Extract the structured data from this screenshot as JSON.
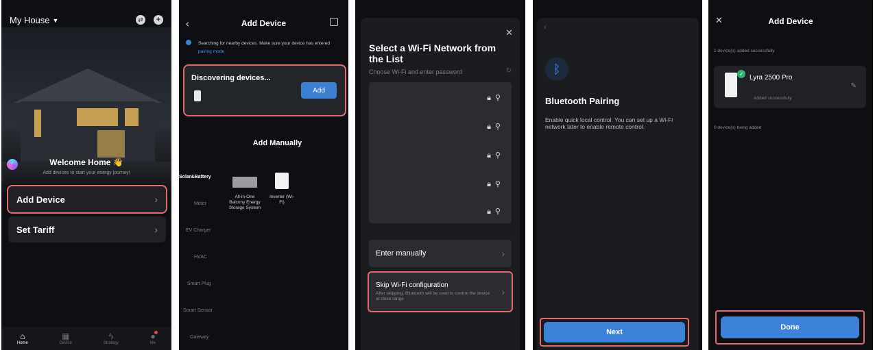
{
  "screen1": {
    "house_name": "My House",
    "title": "Welcome Home",
    "title_emoji": "👋",
    "subtitle": "Add devices to start your energy journey!",
    "menu": [
      {
        "label": "Add Device"
      },
      {
        "label": "Set Tariff"
      }
    ],
    "tabs": [
      {
        "label": "Home",
        "icon": "home-icon"
      },
      {
        "label": "Device",
        "icon": "device-icon"
      },
      {
        "label": "Strategy",
        "icon": "strategy-icon"
      },
      {
        "label": "Me",
        "icon": "me-icon"
      }
    ]
  },
  "screen2": {
    "title": "Add Device",
    "hint_text": "Searching for nearby devices. Make sure your device has entered",
    "hint_link": "pairing mode",
    "discovering_label": "Discovering devices...",
    "add_button": "Add",
    "add_manually_title": "Add Manually",
    "categories": [
      "Solar&Battery",
      "Meter",
      "EV Charger",
      "HVAC",
      "Smart Plug",
      "Smart Sensor",
      "Gateway"
    ],
    "products": [
      {
        "label": "All-in-One Balcony Energy Storage System"
      },
      {
        "label": "Inverter (Wi-Fi)"
      }
    ]
  },
  "screen3": {
    "title": "Select a Wi-Fi Network from the List",
    "subtitle": "Choose Wi-Fi and enter password",
    "enter_manually": "Enter manually",
    "skip_title": "Skip Wi-Fi configuration",
    "skip_desc": "After skipping, Bluetooth will be used to control the device at close range"
  },
  "screen4": {
    "title": "Bluetooth Pairing",
    "desc": "Enable quick local control. You can set up a Wi-Fi network later to enable remote control.",
    "next_button": "Next"
  },
  "screen5": {
    "title": "Add Device",
    "added_count_text": "1 device(s) added successfully",
    "device_name": "Lyra 2500 Pro",
    "device_status": "Added successfully",
    "adding_text": "0 device(s) being added",
    "done_button": "Done"
  },
  "colors": {
    "accent_blue": "#3c82d8",
    "highlight_red": "#e36b6b",
    "success_green": "#2fb573",
    "background": "#0e0f12"
  }
}
